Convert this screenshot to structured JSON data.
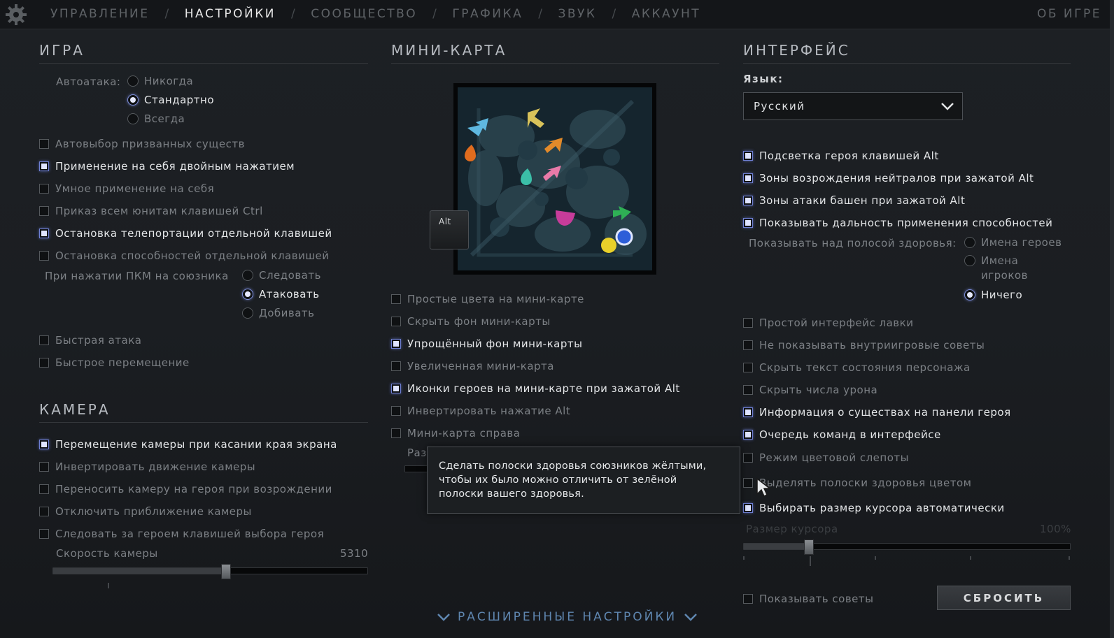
{
  "nav": {
    "tabs": [
      "УПРАВЛЕНИЕ",
      "НАСТРОЙКИ",
      "СООБЩЕСТВО",
      "ГРАФИКА",
      "ЗВУК",
      "АККАУНТ"
    ],
    "separator": "/",
    "active_tab": "НАСТРОЙКИ",
    "about": "ОБ ИГРЕ"
  },
  "game": {
    "title": "ИГРА",
    "autoattack_label": "Автоатака:",
    "autoattack_options": [
      "Никогда",
      "Стандартно",
      "Всегда"
    ],
    "autoattack_selected": "Стандартно",
    "options": [
      {
        "label": "Автовыбор призванных существ",
        "checked": false
      },
      {
        "label": "Применение на себя двойным нажатием",
        "checked": true
      },
      {
        "label": "Умное применение на себя",
        "checked": false
      },
      {
        "label": "Приказ всем юнитам клавишей Ctrl",
        "checked": false
      },
      {
        "label": "Остановка телепортации отдельной клавишей",
        "checked": true
      },
      {
        "label": "Остановка способностей отдельной клавишей",
        "checked": false
      }
    ],
    "rmb_label": "При нажатии ПКМ на союзника",
    "rmb_options": [
      "Следовать",
      "Атаковать",
      "Добивать"
    ],
    "rmb_selected": "Атаковать",
    "options2": [
      {
        "label": "Быстрая атака",
        "checked": false
      },
      {
        "label": "Быстрое перемещение",
        "checked": false
      }
    ]
  },
  "camera": {
    "title": "КАМЕРА",
    "options": [
      {
        "label": "Перемещение камеры при касании края экрана",
        "checked": true
      },
      {
        "label": "Инвертировать движение камеры",
        "checked": false
      },
      {
        "label": "Переносить камеру на героя при возрождении",
        "checked": false
      },
      {
        "label": "Отключить приближение камеры",
        "checked": false
      },
      {
        "label": "Следовать за героем клавишей выбора героя",
        "checked": false
      }
    ],
    "speed_label": "Скорость камеры",
    "speed_value": "5310",
    "speed_fraction": 0.55
  },
  "minimap": {
    "title": "МИНИ-КАРТА",
    "alt_key": "Alt",
    "options": [
      {
        "label": "Простые цвета на мини-карте",
        "checked": false
      },
      {
        "label": "Скрыть фон мини-карты",
        "checked": false
      },
      {
        "label": "Упрощённый фон мини-карты",
        "checked": true
      },
      {
        "label": "Увеличенная мини-карта",
        "checked": false
      },
      {
        "label": "Иконки героев на мини-карте при зажатой Alt",
        "checked": true
      },
      {
        "label": "Инвертировать нажатие Alt",
        "checked": false
      },
      {
        "label": "Мини-карта справа",
        "checked": false
      }
    ],
    "partial_label": "Раз"
  },
  "tooltip": {
    "lines": [
      "Сделать полоски здоровья союзников жёлтыми,",
      "чтобы их было можно отличить от зелёной",
      "полоски вашего здоровья."
    ]
  },
  "interface": {
    "title": "ИНТЕРФЕЙС",
    "language_label": "Язык:",
    "language_value": "Русский",
    "options": [
      {
        "label": "Подсветка героя клавишей Alt",
        "checked": true
      },
      {
        "label": "Зоны возрождения нейтралов при зажатой Alt",
        "checked": true
      },
      {
        "label": "Зоны атаки башен при зажатой Alt",
        "checked": true
      },
      {
        "label": "Показывать дальность применения способностей",
        "checked": true
      }
    ],
    "health_label": "Показывать над полосой здоровья:",
    "health_options": [
      "Имена героев",
      "Имена игроков",
      "Ничего"
    ],
    "health_selected": "Ничего",
    "options2": [
      {
        "label": "Простой интерфейс лавки",
        "checked": false
      },
      {
        "label": "Не показывать внутриигровые советы",
        "checked": false
      },
      {
        "label": "Скрыть текст состояния персонажа",
        "checked": false
      },
      {
        "label": "Скрыть числа урона",
        "checked": false
      },
      {
        "label": "Информация о существах на панели героя",
        "checked": true
      },
      {
        "label": "Очередь команд в интерфейсе",
        "checked": true
      },
      {
        "label": "Режим цветовой слепоты",
        "checked": false
      },
      {
        "label": "Выделять полоски здоровья цветом",
        "checked": false
      },
      {
        "label": "Выбирать размер курсора автоматически",
        "checked": true
      }
    ],
    "cursor_size_label": "Размер курсора",
    "cursor_size_value": "100%",
    "cursor_size_fraction": 0.2,
    "show_tips": {
      "label": "Показывать советы",
      "checked": false
    },
    "reset": "СБРОСИТЬ"
  },
  "advanced": "РАСШИРЕННЫЕ НАСТРОЙКИ"
}
